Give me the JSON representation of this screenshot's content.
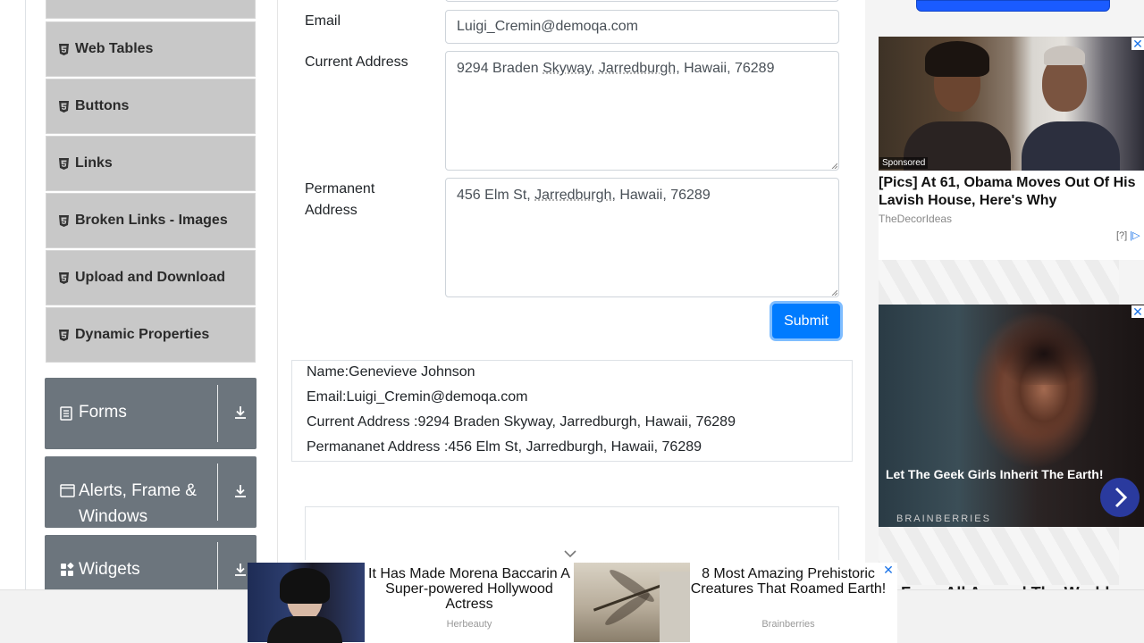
{
  "sidebar": {
    "items": [
      {
        "label": "Web Tables"
      },
      {
        "label": "Buttons"
      },
      {
        "label": "Links"
      },
      {
        "label": "Broken Links - Images"
      },
      {
        "label": "Upload and Download"
      },
      {
        "label": "Dynamic Properties"
      }
    ],
    "groups": [
      {
        "label": "Forms",
        "icon": "form-icon"
      },
      {
        "label": "Alerts, Frame & Windows",
        "icon": "window-icon"
      },
      {
        "label": "Widgets",
        "icon": "widgets-icon"
      }
    ]
  },
  "form": {
    "email_label": "Email",
    "email_value": "Luigi_Cremin@demoqa.com",
    "current_address_label": "Current Address",
    "current_address_parts": [
      "9294 Braden ",
      "Skyway",
      ", ",
      "Jarredburgh",
      ", Hawaii, 76289"
    ],
    "permanent_address_label_line1": "Permanent",
    "permanent_address_label_line2": "Address",
    "permanent_address_parts": [
      "456 Elm St, ",
      "Jarredburgh",
      ", Hawaii, 76289"
    ],
    "submit_label": "Submit"
  },
  "output": {
    "name": "Name:Genevieve Johnson",
    "email": "Email:Luigi_Cremin@demoqa.com",
    "current_address": "Current Address :9294 Braden Skyway, Jarredburgh, Hawaii, 76289",
    "permanent_address": "Permananet Address :456 Elm St, Jarredburgh, Hawaii, 76289"
  },
  "right_ads": {
    "ad1": {
      "sponsored": "Sponsored",
      "title": "[Pics] At 61, Obama Moves Out Of His Lavish House, Here's Why",
      "source": "TheDecorIdeas",
      "info": "[?]"
    },
    "ad2": {
      "title": "Let The Geek Girls Inherit The Earth!",
      "source": "BRAINBERRIES"
    },
    "cut_text": "From All Around The World..."
  },
  "bottom_ads": [
    {
      "title": "It Has Made Morena Baccarin A Super-powered Hollywood Actress",
      "source": "Herbeauty"
    },
    {
      "title": "8 Most Amazing Prehistoric Creatures That Roamed Earth!",
      "source": "Brainberries"
    }
  ],
  "colors": {
    "primary": "#007bff",
    "sidebar_item_bg": "#c8c8c8",
    "group_bg": "#6c757d"
  }
}
